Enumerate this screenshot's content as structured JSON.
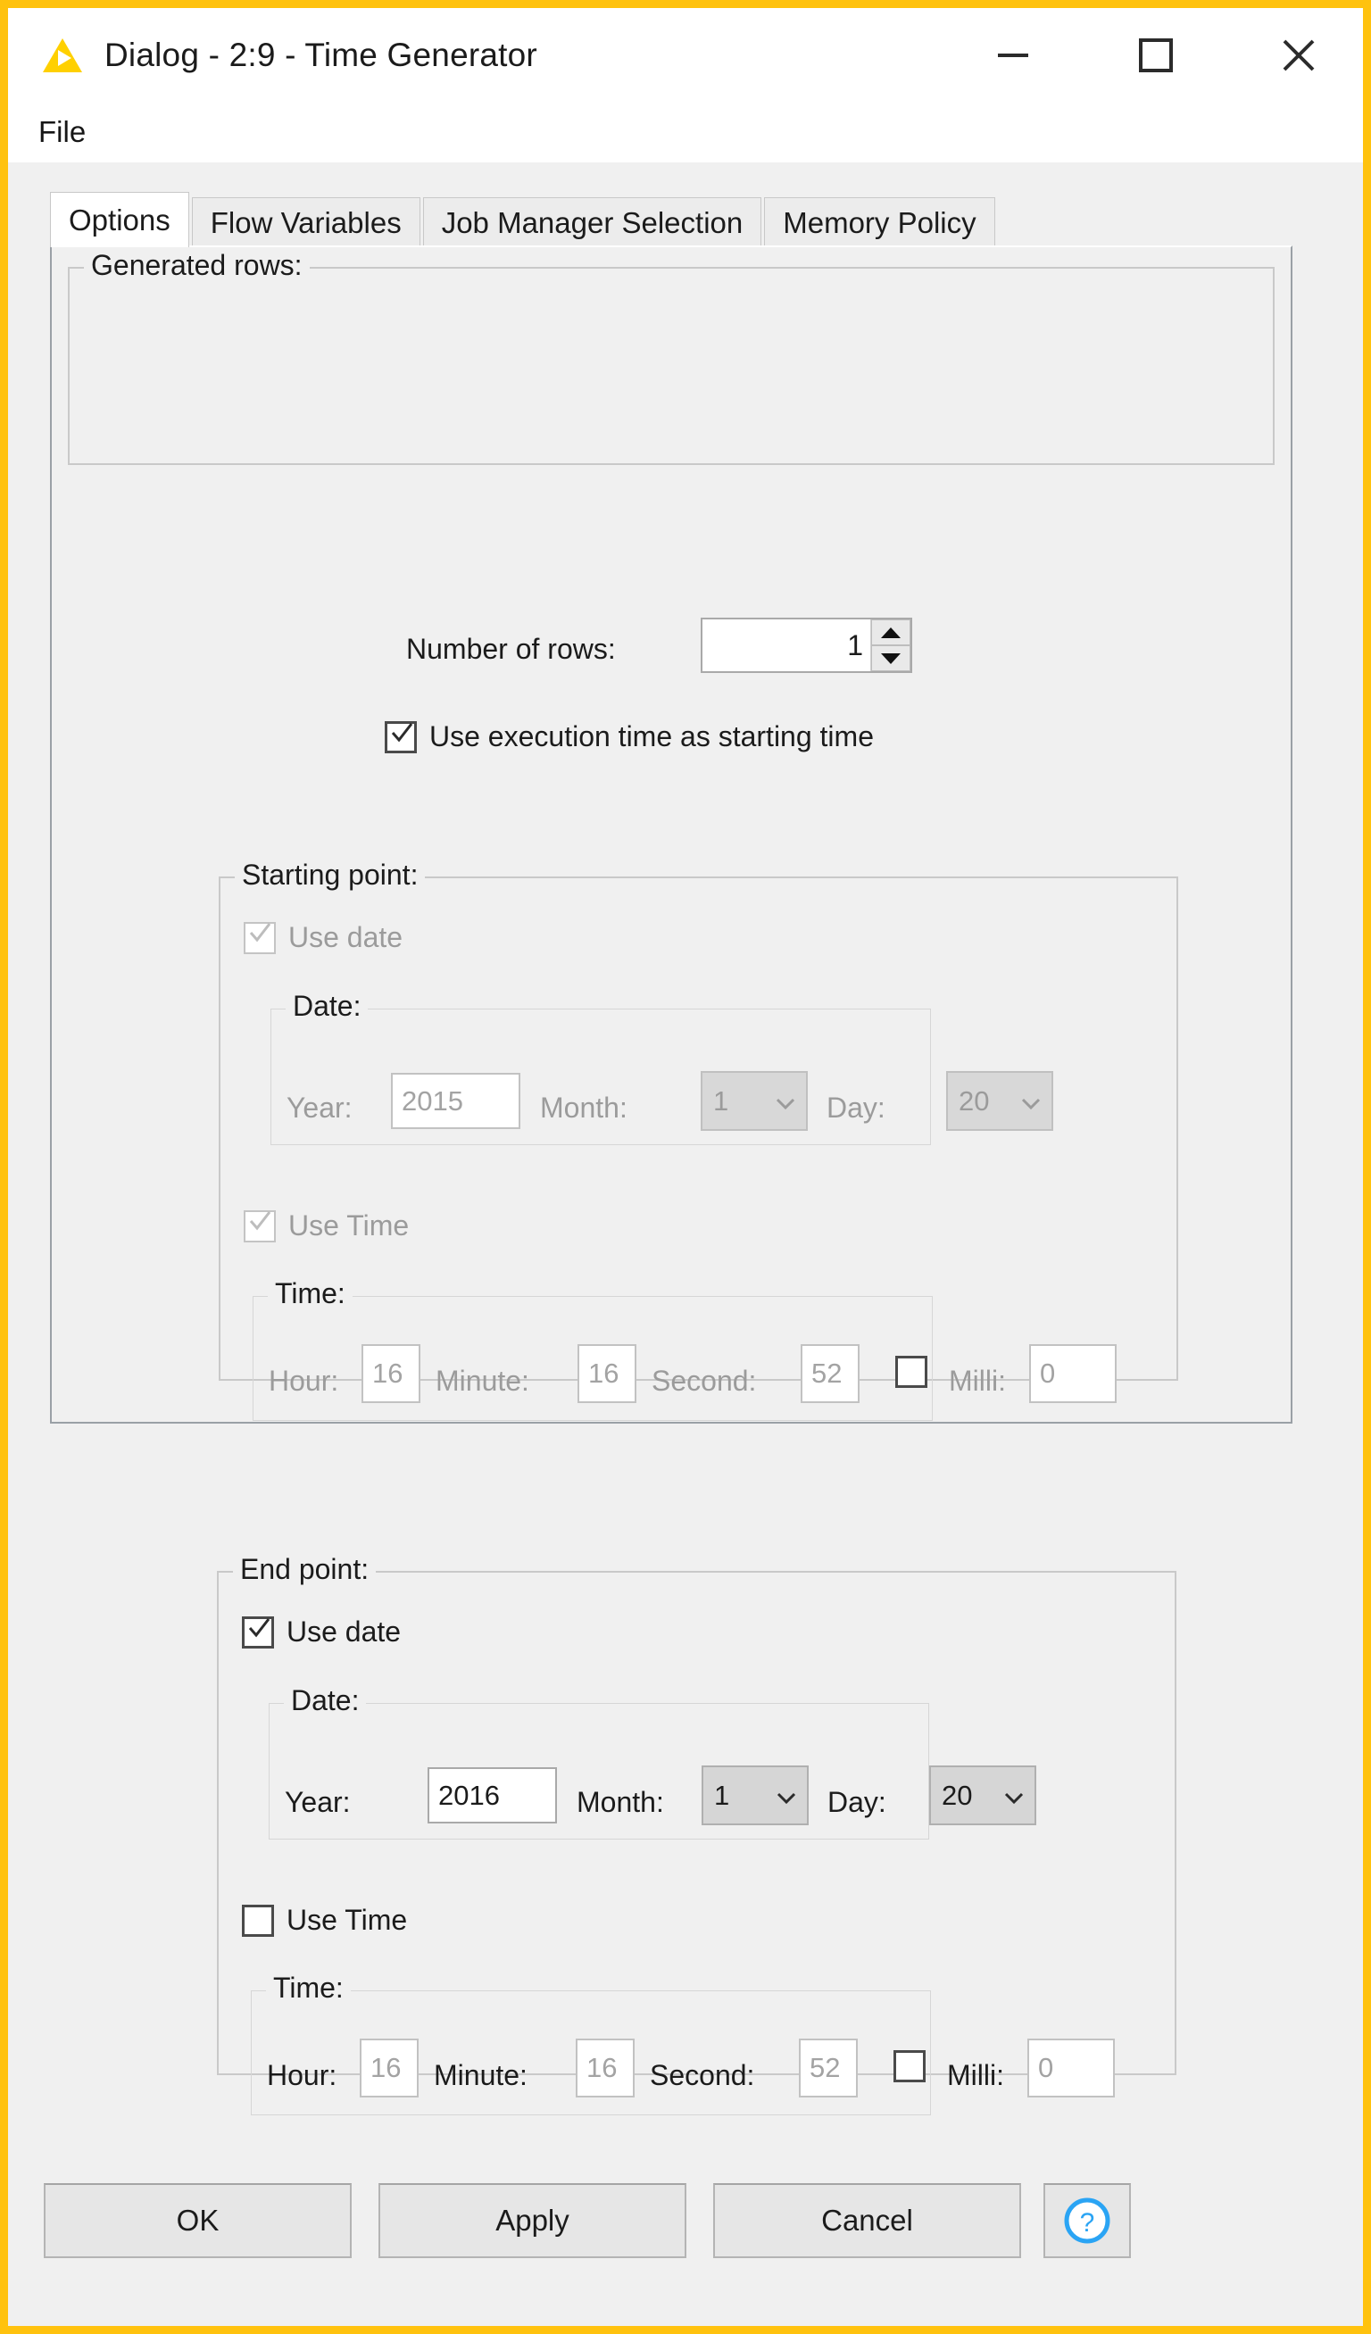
{
  "window": {
    "title": "Dialog - 2:9 - Time Generator",
    "app_icon": "knime-triangle-icon",
    "accent_color": "#ffc20e",
    "controls": {
      "minimize": "minimize-icon",
      "maximize": "maximize-icon",
      "close": "close-icon"
    }
  },
  "menubar": {
    "items": [
      {
        "label": "File"
      }
    ]
  },
  "tabs": [
    {
      "label": "Options",
      "active": true
    },
    {
      "label": "Flow Variables",
      "active": false
    },
    {
      "label": "Job Manager Selection",
      "active": false
    },
    {
      "label": "Memory Policy",
      "active": false
    }
  ],
  "generated_rows": {
    "title": "Generated rows:",
    "number_of_rows_label": "Number of rows:",
    "number_of_rows_value": "1",
    "spinner_up": "spinner-up-icon",
    "spinner_down": "spinner-down-icon"
  },
  "use_execution_time": {
    "label": "Use execution time as starting time",
    "checked": true,
    "enabled": true
  },
  "starting_point": {
    "title": "Starting point:",
    "use_date": {
      "label": "Use date",
      "checked": true,
      "enabled": false
    },
    "date": {
      "title": "Date:",
      "year_label": "Year:",
      "year_value": "2015",
      "month_label": "Month:",
      "month_value": "1",
      "day_label": "Day:",
      "day_value": "20",
      "enabled": false
    },
    "use_time": {
      "label": "Use Time",
      "checked": true,
      "enabled": false
    },
    "time": {
      "title": "Time:",
      "hour_label": "Hour:",
      "hour_value": "16",
      "minute_label": "Minute:",
      "minute_value": "16",
      "second_label": "Second:",
      "second_value": "52",
      "milli_checked": false,
      "milli_label": "Milli:",
      "milli_value": "0",
      "enabled": false
    }
  },
  "end_point": {
    "title": "End point:",
    "use_date": {
      "label": "Use date",
      "checked": true,
      "enabled": true
    },
    "date": {
      "title": "Date:",
      "year_label": "Year:",
      "year_value": "2016",
      "month_label": "Month:",
      "month_value": "1",
      "day_label": "Day:",
      "day_value": "20",
      "enabled": true
    },
    "use_time": {
      "label": "Use Time",
      "checked": false,
      "enabled": true
    },
    "time": {
      "title": "Time:",
      "hour_label": "Hour:",
      "hour_value": "16",
      "minute_label": "Minute:",
      "minute_value": "16",
      "second_label": "Second:",
      "second_value": "52",
      "milli_checked": false,
      "milli_label": "Milli:",
      "milli_value": "0",
      "enabled": false
    }
  },
  "buttons": {
    "ok": "OK",
    "apply": "Apply",
    "cancel": "Cancel",
    "help": "help-icon"
  }
}
